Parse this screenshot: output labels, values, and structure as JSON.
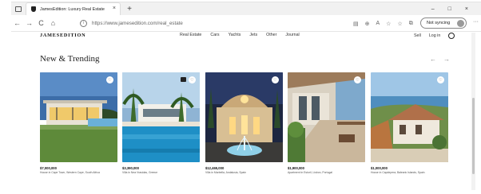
{
  "browser": {
    "tab_title": "JamesEdition: Luxury Real Estate",
    "tab_close": "×",
    "new_tab": "+",
    "window_minimize": "–",
    "window_maximize": "□",
    "window_close": "×",
    "back": "←",
    "forward": "→",
    "reload": "C",
    "home": "⌂",
    "url": "https://www.jamesedition.com/real_estate",
    "sync_label": "Not syncing",
    "more": "···"
  },
  "site": {
    "logo": "JAMESEDITION",
    "nav": [
      "Real Estate",
      "Cars",
      "Yachts",
      "Jets",
      "Other",
      "Journal"
    ],
    "sell": "Sell",
    "login": "Log in"
  },
  "section": {
    "title": "New & Trending",
    "prev": "←",
    "next": "→"
  },
  "listings": [
    {
      "price": "$7,000,000",
      "location": "House in Cape Town, Western Cape, South Africa"
    },
    {
      "price": "$3,390,000",
      "location": "Villa in Nea Vrasidas, Greece"
    },
    {
      "price": "$12,465,000",
      "location": "Villa in Marbella, Andalusia, Spain"
    },
    {
      "price": "$1,900,000",
      "location": "Apartment in Estoril, Lisbon, Portugal"
    },
    {
      "price": "$1,000,000",
      "location": "House in Capdepera, Balearic Islands, Spain"
    }
  ],
  "icons": {
    "heart": "♡",
    "lock": "i",
    "tb_reader": "▤",
    "tb_zoom": "⊕",
    "tb_read_aloud": "A",
    "tb_favorite": "☆",
    "tb_favorites": "☆",
    "tb_collections": "⧉"
  }
}
